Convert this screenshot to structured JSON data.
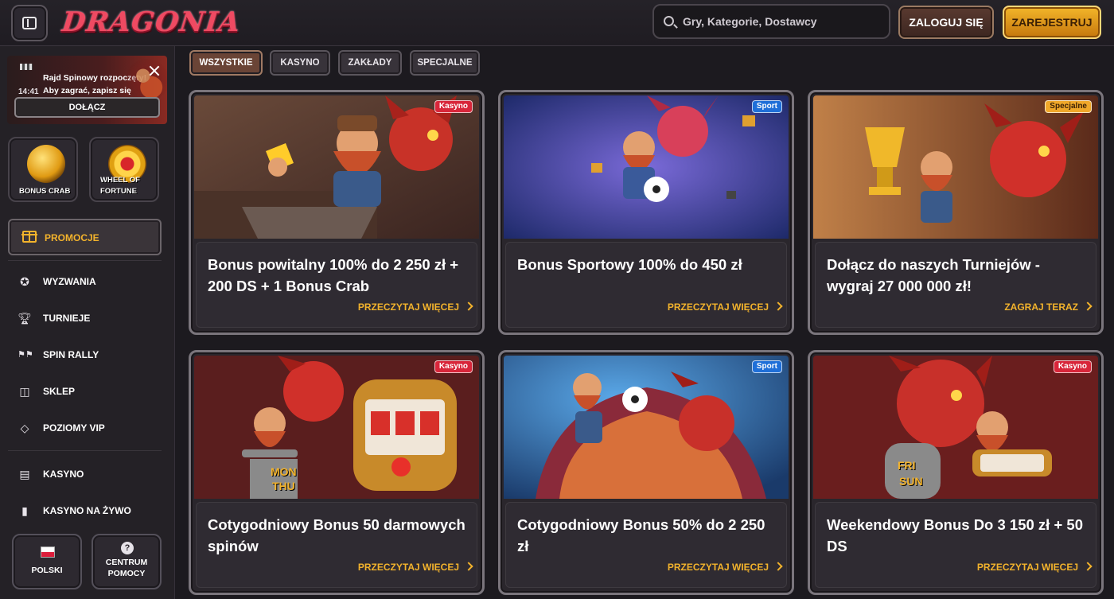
{
  "header": {
    "logo_text": "DRAGONIA",
    "search_placeholder": "Gry, Kategorie, Dostawcy",
    "login_label": "ZALOGUJ SIĘ",
    "register_label": "ZAREJESTRUJ"
  },
  "sidebar": {
    "rally": {
      "line1": "Rajd Spinowy rozpoczęty!",
      "line2": "Aby zagrać, zapisz się",
      "time": "14:41",
      "join_label": "DOŁĄCZ"
    },
    "tiles": [
      {
        "label": "BONUS CRAB"
      },
      {
        "label_line1": "WHEEL OF",
        "label_line2": "FORTUNE"
      }
    ],
    "promo_label": "PROMOCJE",
    "nav": [
      {
        "label": "WYZWANIA",
        "icon": "medal-icon"
      },
      {
        "label": "TURNIEJE",
        "icon": "trophy-icon"
      },
      {
        "label": "SPIN RALLY",
        "icon": "race-flag-icon"
      },
      {
        "label": "SKLEP",
        "icon": "shopping-basket-icon"
      },
      {
        "label": "POZIOMY VIP",
        "icon": "diamond-icon"
      },
      {
        "label": "KASYNO",
        "icon": "slot-machine-icon"
      },
      {
        "label": "KASYNO NA ŻYWO",
        "icon": "playing-card-icon"
      }
    ],
    "language_label": "POLSKI",
    "help_line1": "CENTRUM",
    "help_line2": "POMOCY"
  },
  "filters": [
    {
      "label": "WSZYSTKIE",
      "active": true
    },
    {
      "label": "KASYNO",
      "active": false
    },
    {
      "label": "ZAKŁADY",
      "active": false
    },
    {
      "label": "SPECJALNE",
      "active": false
    }
  ],
  "cards": [
    {
      "badge": "Kasyno",
      "title": "Bonus powitalny 100% do 2 250 zł + 200 DS + 1 Bonus Crab",
      "cta": "PRZECZYTAJ WIĘCEJ"
    },
    {
      "badge": "Sport",
      "title": "Bonus Sportowy 100% do 450 zł",
      "cta": "PRZECZYTAJ WIĘCEJ"
    },
    {
      "badge": "Specjalne",
      "title": "Dołącz do naszych Turniejów - wygraj 27 000 000 zł!",
      "cta": "ZAGRAJ TERAZ"
    },
    {
      "badge": "Kasyno",
      "title": "Cotygodniowy Bonus 50 darmowych spinów",
      "cta": "PRZECZYTAJ WIĘCEJ",
      "sign_line1": "MON",
      "sign_line2": "THU"
    },
    {
      "badge": "Sport",
      "title": "Cotygodniowy Bonus 50% do 2 250 zł",
      "cta": "PRZECZYTAJ WIĘCEJ"
    },
    {
      "badge": "Kasyno",
      "title": "Weekendowy Bonus Do 3 150 zł + 50 DS",
      "cta": "PRZECZYTAJ WIĘCEJ",
      "sign_line1": "FRI",
      "sign_line2": "SUN"
    }
  ],
  "colors": {
    "accent": "#f3b32c",
    "background": "#1c1a1f",
    "casino_badge": "#d8263a",
    "sport_badge": "#1f6fd8",
    "special_badge": "#f0a82a"
  }
}
